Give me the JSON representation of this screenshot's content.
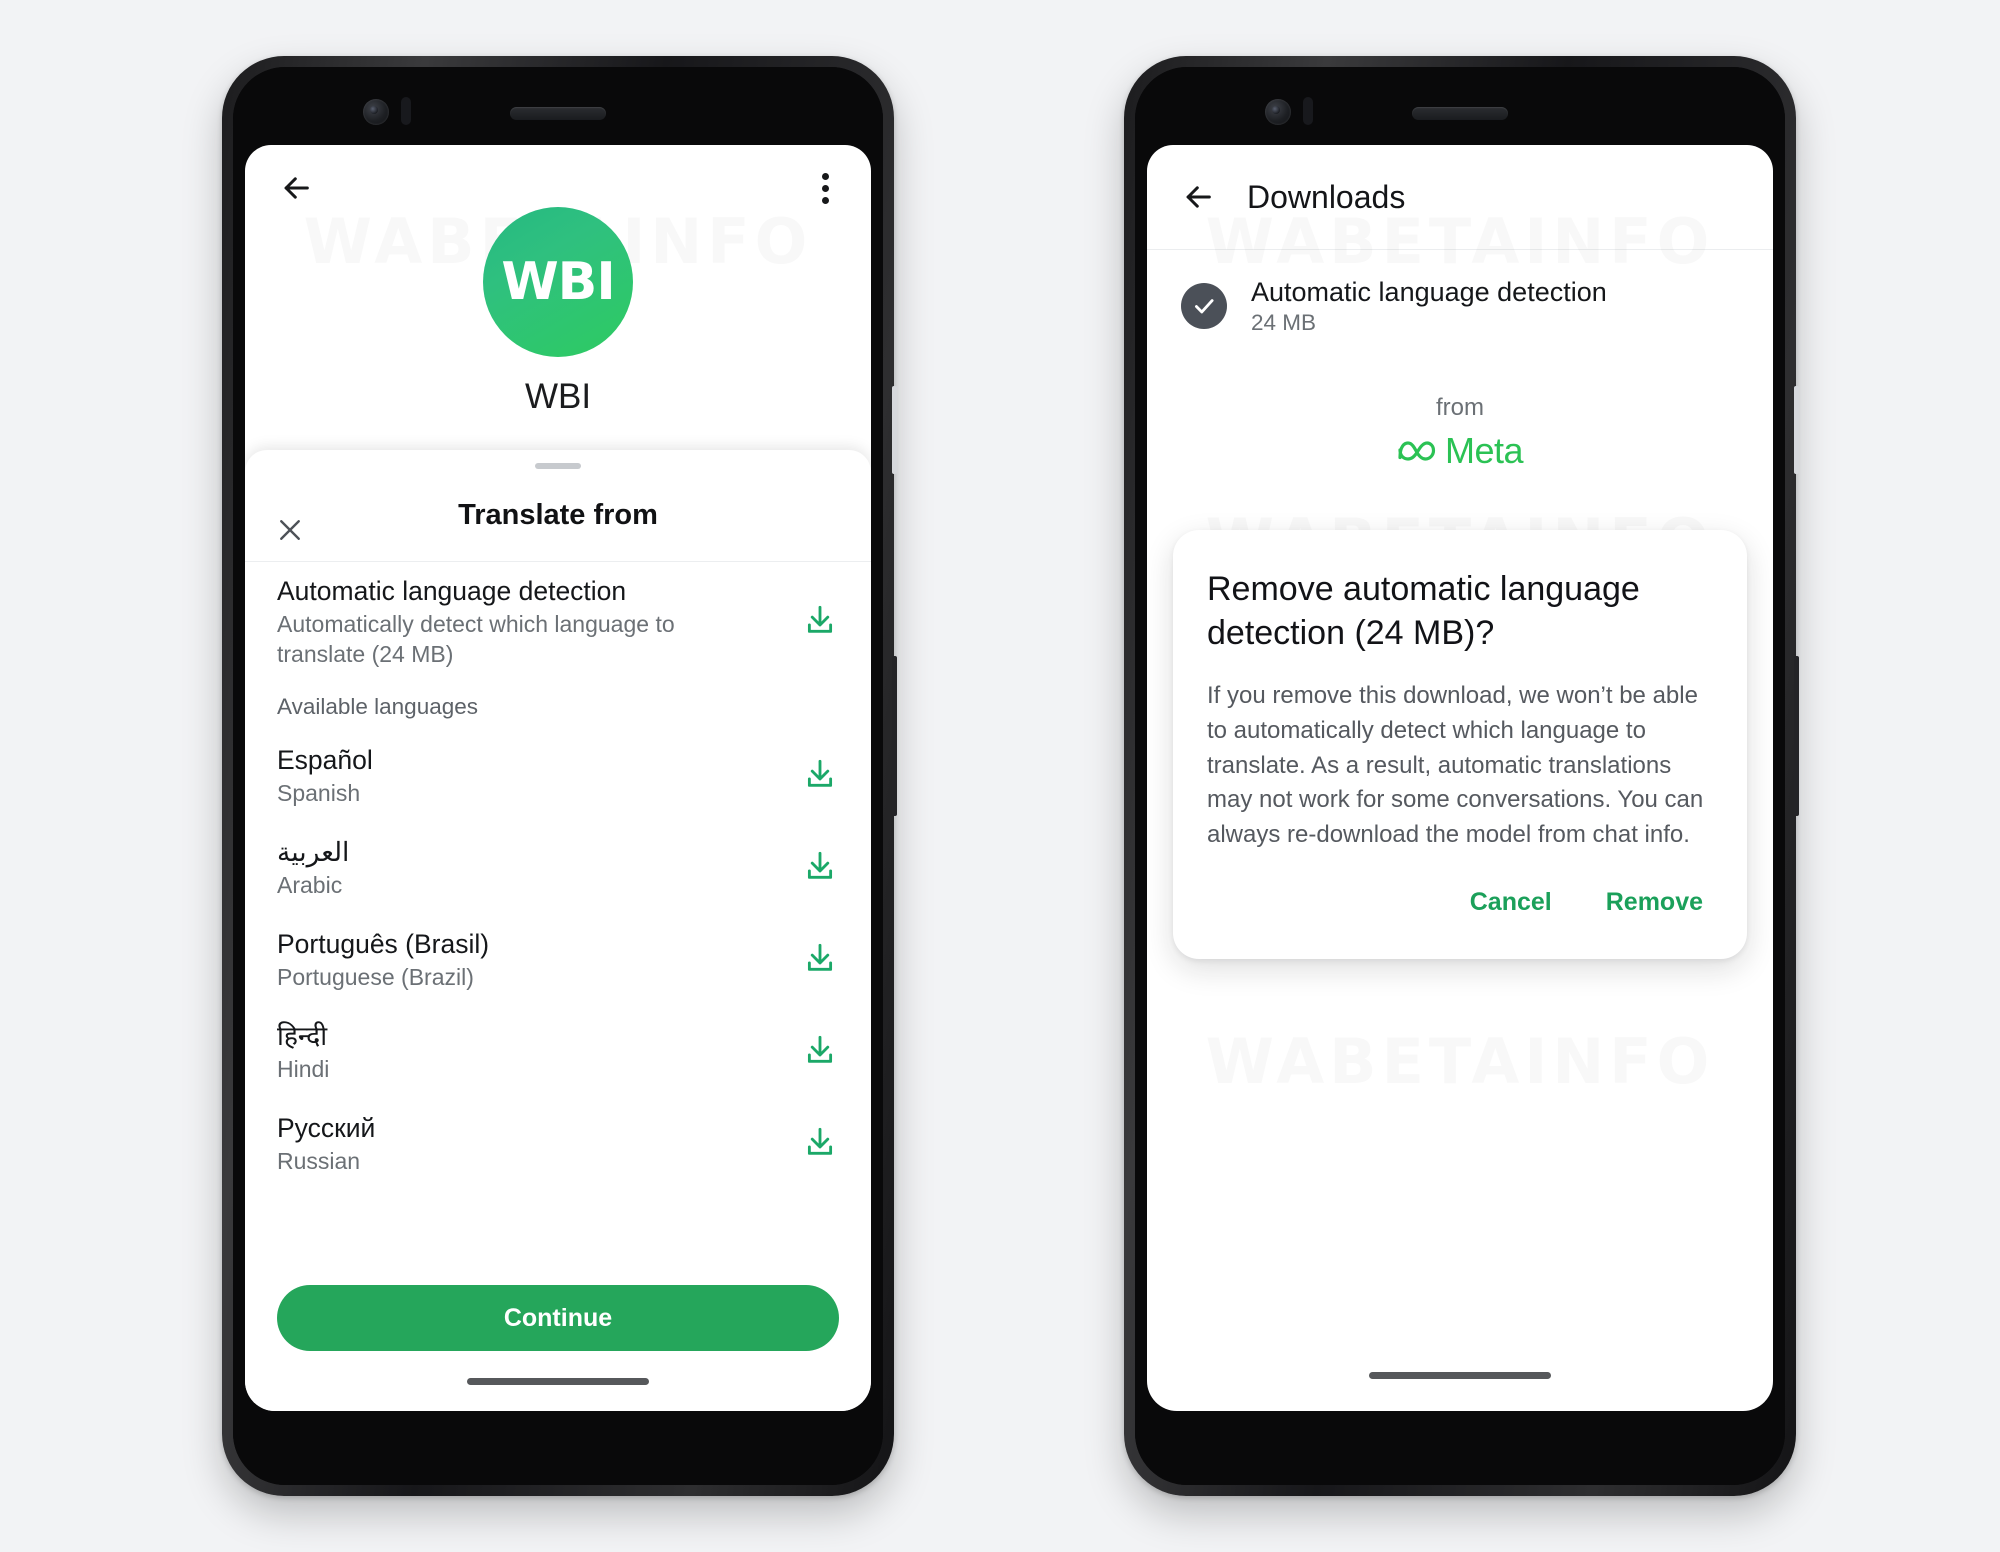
{
  "watermark": "WABETAINFO",
  "colors": {
    "brand_green": "#25a65b",
    "accent_green": "#1ba05a",
    "meta_green": "#2bc254",
    "page_background": "#f2f3f5"
  },
  "left_phone": {
    "topbar": {
      "back_icon": "arrow-left-icon",
      "overflow_icon": "more-vertical-icon"
    },
    "profile": {
      "avatar_text": "WBI",
      "name": "WBI"
    },
    "sheet": {
      "close_icon": "close-icon",
      "title": "Translate from",
      "auto_detect": {
        "primary": "Automatic language detection",
        "secondary": "Automatically detect which language to translate (24 MB)",
        "action_icon": "download-icon"
      },
      "section_label": "Available languages",
      "languages": [
        {
          "native": "Español",
          "english": "Spanish",
          "action_icon": "download-icon"
        },
        {
          "native": "العربية",
          "english": "Arabic",
          "action_icon": "download-icon"
        },
        {
          "native": "Português (Brasil)",
          "english": "Portuguese (Brazil)",
          "action_icon": "download-icon"
        },
        {
          "native": "हिन्दी",
          "english": "Hindi",
          "action_icon": "download-icon"
        },
        {
          "native": "Русский",
          "english": "Russian",
          "action_icon": "download-icon"
        }
      ],
      "continue_label": "Continue"
    }
  },
  "right_phone": {
    "topbar": {
      "back_icon": "arrow-left-icon",
      "title": "Downloads"
    },
    "download_item": {
      "status_icon": "check-circle-icon",
      "primary": "Automatic language detection",
      "secondary": "24 MB"
    },
    "from": {
      "label": "from",
      "brand_icon": "meta-infinity-icon",
      "brand_name": "Meta"
    },
    "dialog": {
      "title": "Remove automatic language detection (24 MB)?",
      "body": "If you remove this download, we won’t be able to automatically detect which language to translate. As a result, automatic translations may not work for some conversations. You can always re-download the model from chat info.",
      "cancel_label": "Cancel",
      "remove_label": "Remove"
    }
  }
}
